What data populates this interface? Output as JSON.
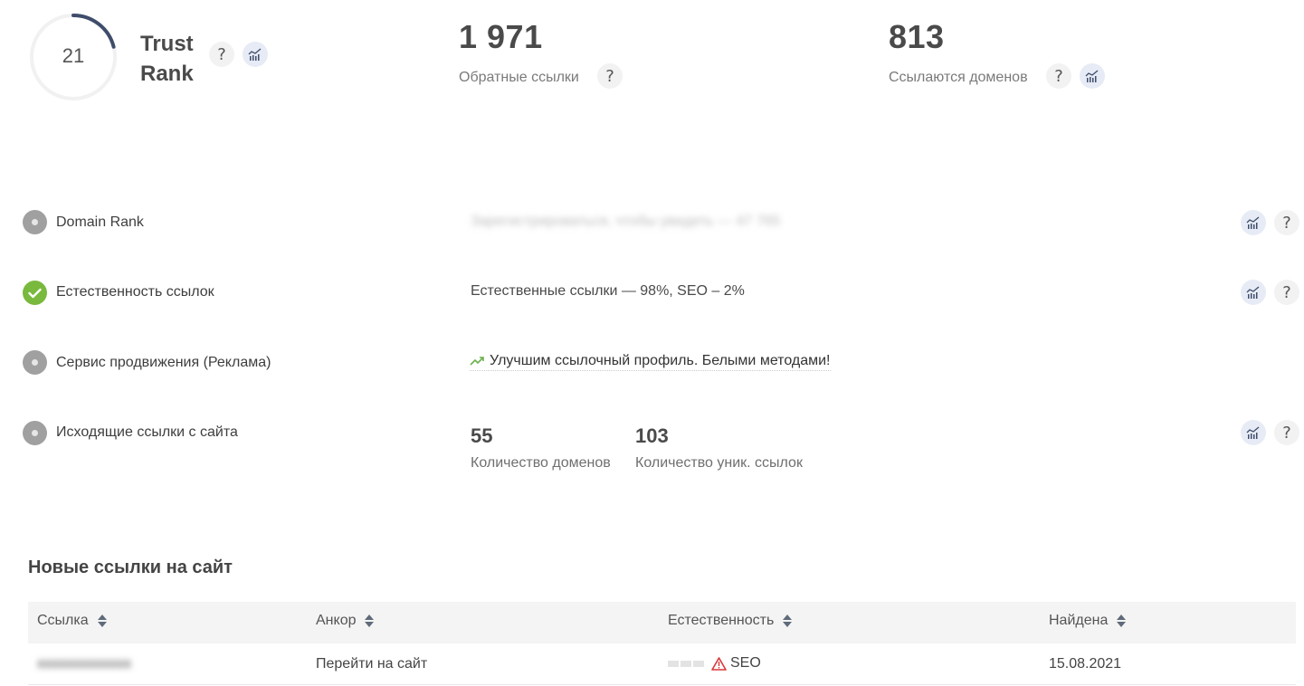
{
  "trust_rank": {
    "value": "21",
    "label_line1": "Trust",
    "label_line2": "Rank",
    "progress": 0.21
  },
  "backlinks": {
    "value": "1 971",
    "label": "Обратные ссылки"
  },
  "ref_domains": {
    "value": "813",
    "label": "Ссылаются доменов"
  },
  "rows": [
    {
      "label": "Domain Rank",
      "value": "Зарегистрироваться, чтобы увидеть — 47 765",
      "status": "grey"
    },
    {
      "label": "Естественность ссылок",
      "value": "Естественные ссылки — 98%, SEO – 2%",
      "status": "green"
    },
    {
      "label": "Сервис продвижения (Реклама)",
      "value": "Улучшим ссылочный профиль. Белыми методами!",
      "status": "grey"
    },
    {
      "label": "Исходящие ссылки с сайта",
      "status": "grey",
      "domains_count": "55",
      "domains_label": "Количество доменов",
      "links_count": "103",
      "links_label": "Количество уник. ссылок"
    }
  ],
  "new_links": {
    "title": "Новые ссылки на сайт",
    "columns": [
      "Ссылка",
      "Анкор",
      "Естественность",
      "Найдена"
    ],
    "rows": [
      {
        "link": "xxxxxxxxxxxxx",
        "anchor": "Перейти на сайт",
        "naturalness": "SEO",
        "found": "15.08.2021"
      }
    ]
  },
  "colors": {
    "accent_navy": "#3f4d6b",
    "green_ok": "#79b93d",
    "status_grey": "#a0a0a0",
    "warning_red": "#d9383a"
  },
  "icons": {
    "help": "question-icon",
    "chart": "chart-icon",
    "trend": "trend-up-icon",
    "warning": "warning-triangle-icon",
    "sort": "sort-icon"
  }
}
